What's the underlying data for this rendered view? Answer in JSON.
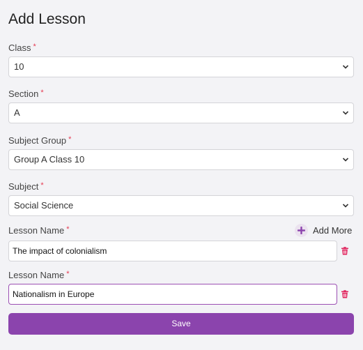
{
  "page": {
    "title": "Add Lesson"
  },
  "form": {
    "required_mark": "*",
    "class_field": {
      "label": "Class",
      "value": "10"
    },
    "section_field": {
      "label": "Section",
      "value": "A"
    },
    "subject_group_field": {
      "label": "Subject Group",
      "value": "Group A Class 10"
    },
    "subject_field": {
      "label": "Subject",
      "value": "Social Science"
    },
    "lessons": [
      {
        "label": "Lesson Name",
        "value": "The impact of colonialism"
      },
      {
        "label": "Lesson Name",
        "value": "Nationalism in Europe"
      }
    ],
    "add_more_label": "Add More",
    "save_label": "Save"
  },
  "icons": {
    "dropdown": "chevron-down-icon",
    "add": "plus-icon",
    "delete": "trash-icon"
  },
  "colors": {
    "accent": "#8b44ad",
    "required": "#e53950",
    "delete": "#e0245e",
    "background": "#f3f3f6"
  }
}
